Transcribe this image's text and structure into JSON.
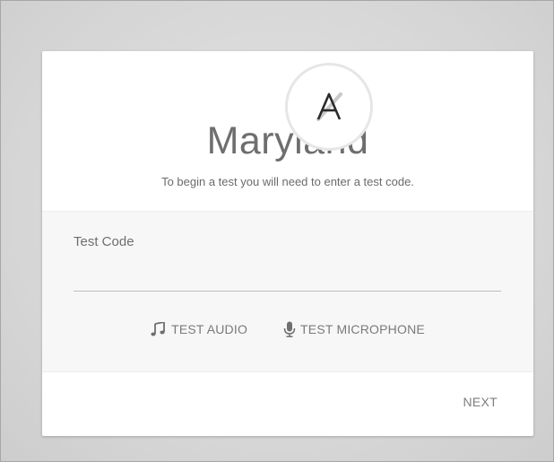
{
  "logo": {
    "icon": "state-logo-A-icon",
    "letter": "A"
  },
  "header": {
    "title": "Maryland",
    "subtitle": "To begin a test you will need to enter a test code."
  },
  "form": {
    "test_code_label": "Test Code",
    "test_code_value": "",
    "test_code_placeholder": ""
  },
  "actions": {
    "test_audio": {
      "icon": "music-note-icon",
      "label": "TEST AUDIO"
    },
    "test_microphone": {
      "icon": "microphone-icon",
      "label": "TEST MICROPHONE"
    }
  },
  "footer": {
    "next_label": "NEXT"
  },
  "colors": {
    "title": "#6e6e6e",
    "muted_text": "#7a7a7a",
    "form_background": "#f7f7f7",
    "page_background": "#d8d8d8"
  }
}
